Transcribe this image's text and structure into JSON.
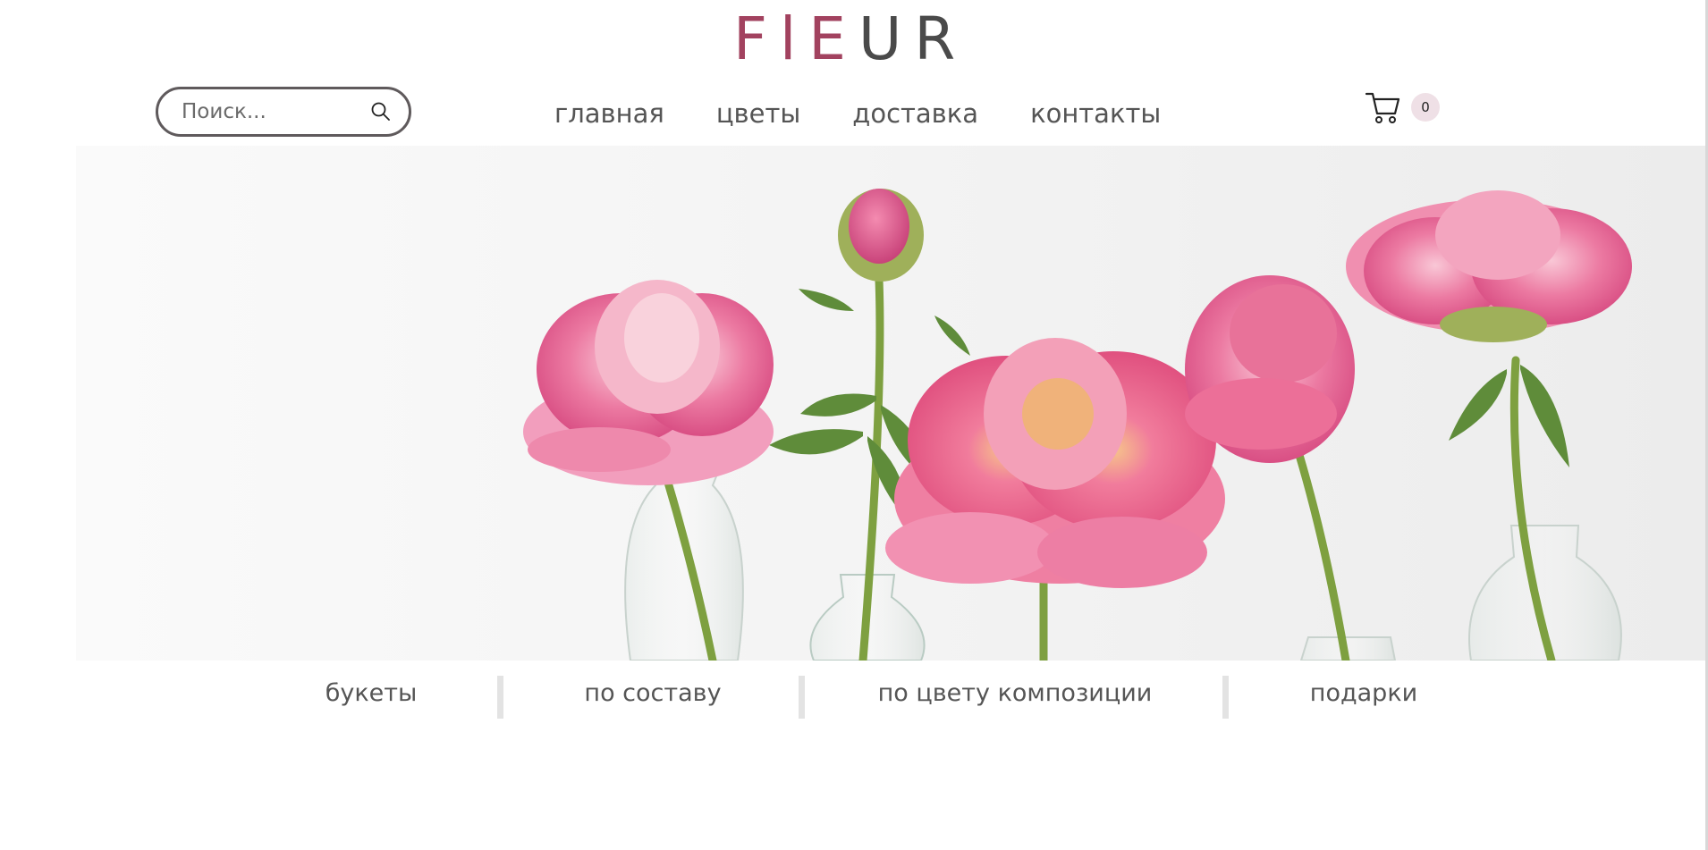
{
  "logo": {
    "part1": "FlE",
    "part2": "UR"
  },
  "search": {
    "placeholder": "Поиск...",
    "value": ""
  },
  "nav": {
    "items": [
      {
        "label": "главная"
      },
      {
        "label": "цветы"
      },
      {
        "label": "доставка"
      },
      {
        "label": "контакты"
      }
    ]
  },
  "cart": {
    "count": "0",
    "icon": "cart-icon"
  },
  "categories": {
    "items": [
      {
        "label": "букеты"
      },
      {
        "label": "по составу"
      },
      {
        "label": "по цвету композиции"
      },
      {
        "label": "подарки"
      }
    ]
  },
  "colors": {
    "brand_pink": "#a2425f",
    "brand_grey": "#4a4a4a",
    "badge_bg": "#efe0e6",
    "peony_pink": "#e8628f"
  }
}
